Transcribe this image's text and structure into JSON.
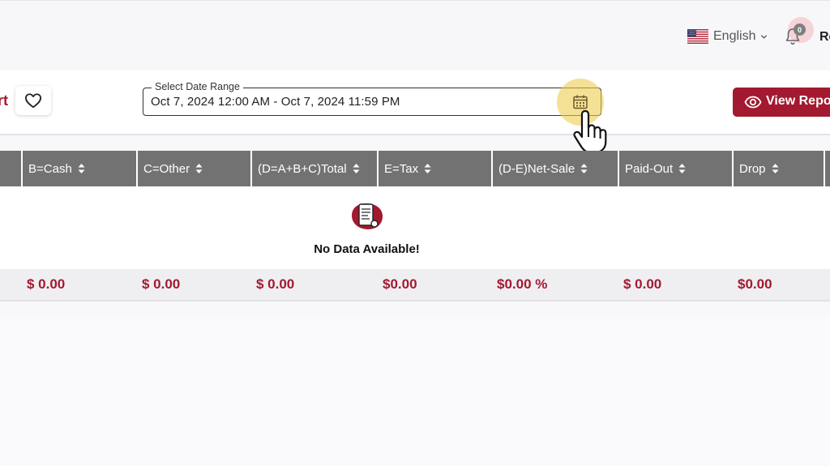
{
  "header": {
    "language": "English",
    "notifications_count": "0",
    "user_initial": "Re"
  },
  "toolbar": {
    "title_fragment": "rt",
    "date_range_label": "Select Date Range",
    "date_range_value": "Oct 7, 2024 12:00 AM - Oct 7, 2024 11:59 PM",
    "view_button_label": "View Repo"
  },
  "table": {
    "columns": [
      "B=Cash",
      "C=Other",
      "(D=A+B+C)Total",
      "E=Tax",
      "(D-E)Net-Sale",
      "Paid-Out",
      "Drop"
    ],
    "empty_message": "No Data Available!",
    "totals": [
      "$ 0.00",
      "$ 0.00",
      "$ 0.00",
      "$0.00",
      "$0.00 %",
      "$ 0.00",
      "$0.00"
    ]
  },
  "icons": {
    "language_flag": "us-flag-icon",
    "notifications": "bell-icon",
    "favorite": "heart-icon",
    "calendar": "calendar-icon",
    "pointer": "hand-cursor-icon",
    "view": "eye-icon",
    "sort": "sort-icon",
    "empty": "no-data-icon"
  },
  "colors": {
    "brand": "#a3192f",
    "table_header": "#727272",
    "highlight": "#eecd50"
  }
}
